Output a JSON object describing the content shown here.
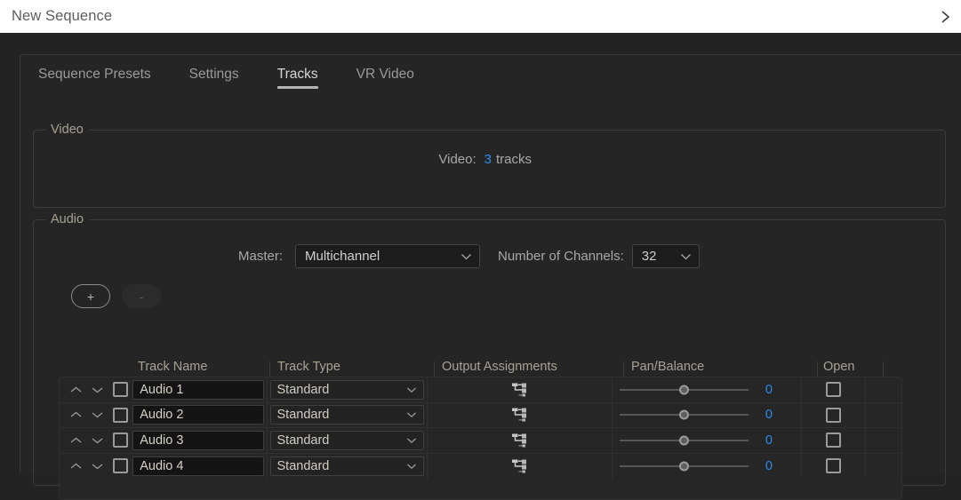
{
  "window": {
    "title": "New Sequence",
    "expand_icon": "chevron-right-icon"
  },
  "tabs": [
    {
      "label": "Sequence Presets",
      "active": false
    },
    {
      "label": "Settings",
      "active": false
    },
    {
      "label": "Tracks",
      "active": true
    },
    {
      "label": "VR Video",
      "active": false
    }
  ],
  "video_group": {
    "title": "Video",
    "row_label": "Video:",
    "count": "3",
    "unit": "tracks"
  },
  "audio_group": {
    "title": "Audio",
    "master_label": "Master:",
    "master_value": "Multichannel",
    "channels_label": "Number of Channels:",
    "channels_value": "32",
    "add_label": "+",
    "remove_label": "-",
    "headers": {
      "track_name": "Track Name",
      "track_type": "Track Type",
      "output_assignments": "Output Assignments",
      "pan_balance": "Pan/Balance",
      "open": "Open"
    },
    "tracks": [
      {
        "name": "Audio 1",
        "type": "Standard",
        "pan": "0",
        "checked": false,
        "open": false
      },
      {
        "name": "Audio 2",
        "type": "Standard",
        "pan": "0",
        "checked": false,
        "open": false
      },
      {
        "name": "Audio 3",
        "type": "Standard",
        "pan": "0",
        "checked": false,
        "open": false
      },
      {
        "name": "Audio 4",
        "type": "Standard",
        "pan": "0",
        "checked": false,
        "open": false
      }
    ]
  },
  "colors": {
    "accent_blue": "#2d8ceb",
    "label_tan": "#a8a296",
    "panel_bg": "#252525",
    "app_bg": "#232323",
    "titlebar_bg": "#ffffff"
  },
  "icons": {
    "routing": "audio-routing-icon",
    "move_up": "chevron-up-icon",
    "move_down": "chevron-down-icon",
    "dropdown": "chevron-down-icon",
    "checkbox": "checkbox-icon"
  }
}
